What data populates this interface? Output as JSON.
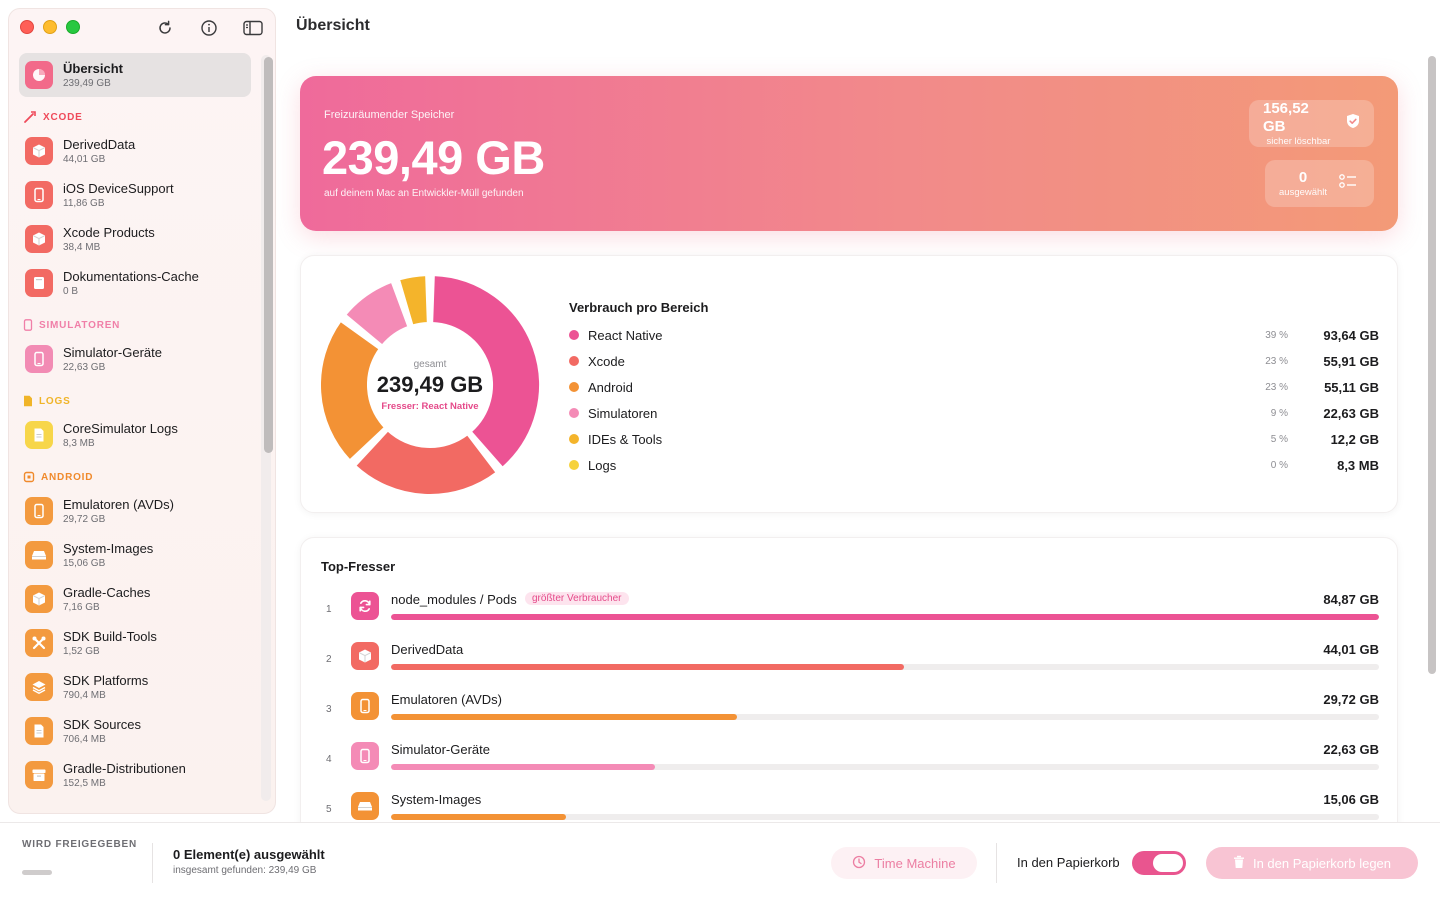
{
  "window": {
    "title": "Übersicht"
  },
  "sidebar": {
    "overview": {
      "label": "Übersicht",
      "size": "239,49 GB"
    },
    "sections": [
      {
        "title": "XCODE",
        "color": "#ef4a5a",
        "items": [
          {
            "label": "DerivedData",
            "size": "44,01 GB",
            "icon": "cube-icon",
            "color": "#f26a63"
          },
          {
            "label": "iOS DeviceSupport",
            "size": "11,86 GB",
            "icon": "phone-icon",
            "color": "#f26a63"
          },
          {
            "label": "Xcode Products",
            "size": "38,4 MB",
            "icon": "cube-icon",
            "color": "#f26a63"
          },
          {
            "label": "Dokumentations-Cache",
            "size": "0 B",
            "icon": "book-icon",
            "color": "#f26a63"
          }
        ]
      },
      {
        "title": "SIMULATOREN",
        "color": "#f07fa8",
        "items": [
          {
            "label": "Simulator-Geräte",
            "size": "22,63 GB",
            "icon": "phone-icon",
            "color": "#f28bb4"
          }
        ]
      },
      {
        "title": "LOGS",
        "color": "#f0b429",
        "items": [
          {
            "label": "CoreSimulator Logs",
            "size": "8,3 MB",
            "icon": "document-icon",
            "color": "#f7d64a"
          }
        ]
      },
      {
        "title": "ANDROID",
        "color": "#f08a2c",
        "items": [
          {
            "label": "Emulatoren (AVDs)",
            "size": "29,72 GB",
            "icon": "phone-icon",
            "color": "#f39a3f"
          },
          {
            "label": "System-Images",
            "size": "15,06 GB",
            "icon": "drive-icon",
            "color": "#f39a3f"
          },
          {
            "label": "Gradle-Caches",
            "size": "7,16 GB",
            "icon": "cube-icon",
            "color": "#f39a3f"
          },
          {
            "label": "SDK Build-Tools",
            "size": "1,52 GB",
            "icon": "tools-icon",
            "color": "#f39a3f"
          },
          {
            "label": "SDK Platforms",
            "size": "790,4 MB",
            "icon": "layers-icon",
            "color": "#f39a3f"
          },
          {
            "label": "SDK Sources",
            "size": "706,4 MB",
            "icon": "document-icon",
            "color": "#f39a3f"
          },
          {
            "label": "Gradle-Distributionen",
            "size": "152,5 MB",
            "icon": "archive-icon",
            "color": "#f39a3f"
          }
        ]
      }
    ]
  },
  "hero": {
    "caption": "Freizuräumender Speicher",
    "value": "239,49 GB",
    "subtitle": "auf deinem Mac an Entwickler-Müll gefunden",
    "safe_value": "156,52 GB",
    "safe_label": "sicher löschbar",
    "selected_value": "0",
    "selected_label": "ausgewählt"
  },
  "usage": {
    "title": "Verbrauch pro Bereich",
    "center_label": "gesamt",
    "center_value": "239,49 GB",
    "center_sub": "Fresser: React Native",
    "items": [
      {
        "name": "React Native",
        "pct": "39 %",
        "value": "93,64 GB",
        "gb": 93.64,
        "color": "#ec5394"
      },
      {
        "name": "Xcode",
        "pct": "23 %",
        "value": "55,91 GB",
        "gb": 55.91,
        "color": "#f26a63"
      },
      {
        "name": "Android",
        "pct": "23 %",
        "value": "55,11 GB",
        "gb": 55.11,
        "color": "#f39235"
      },
      {
        "name": "Simulatoren",
        "pct": "9 %",
        "value": "22,63 GB",
        "gb": 22.63,
        "color": "#f48bb6"
      },
      {
        "name": "IDEs & Tools",
        "pct": "5 %",
        "value": "12,2 GB",
        "gb": 12.2,
        "color": "#f4b42b"
      },
      {
        "name": "Logs",
        "pct": "0 %",
        "value": "8,3 MB",
        "gb": 0.0083,
        "color": "#f6d23c"
      }
    ]
  },
  "top": {
    "title": "Top-Fresser",
    "items": [
      {
        "rank": "1",
        "name": "node_modules / Pods",
        "badge": "größter Verbraucher",
        "value": "84,87 GB",
        "fraction": 1.0,
        "color": "#ec5394",
        "icon": "refresh-icon"
      },
      {
        "rank": "2",
        "name": "DerivedData",
        "badge": "",
        "value": "44,01 GB",
        "fraction": 0.519,
        "color": "#f26a63",
        "icon": "cube-icon"
      },
      {
        "rank": "3",
        "name": "Emulatoren (AVDs)",
        "badge": "",
        "value": "29,72 GB",
        "fraction": 0.35,
        "color": "#f39235",
        "icon": "phone-icon"
      },
      {
        "rank": "4",
        "name": "Simulator-Geräte",
        "badge": "",
        "value": "22,63 GB",
        "fraction": 0.267,
        "color": "#f48bb6",
        "icon": "phone-icon"
      },
      {
        "rank": "5",
        "name": "System-Images",
        "badge": "",
        "value": "15,06 GB",
        "fraction": 0.177,
        "color": "#f39235",
        "icon": "drive-icon"
      }
    ]
  },
  "bottom": {
    "releasing_label": "WIRD FREIGEGEBEN",
    "selection": "0 Element(e) ausgewählt",
    "found": "insgesamt gefunden: 239,49 GB",
    "time_machine": "Time Machine",
    "trash_label": "In den Papierkorb",
    "trash_toggle": true,
    "delete_button": "In den Papierkorb legen"
  }
}
